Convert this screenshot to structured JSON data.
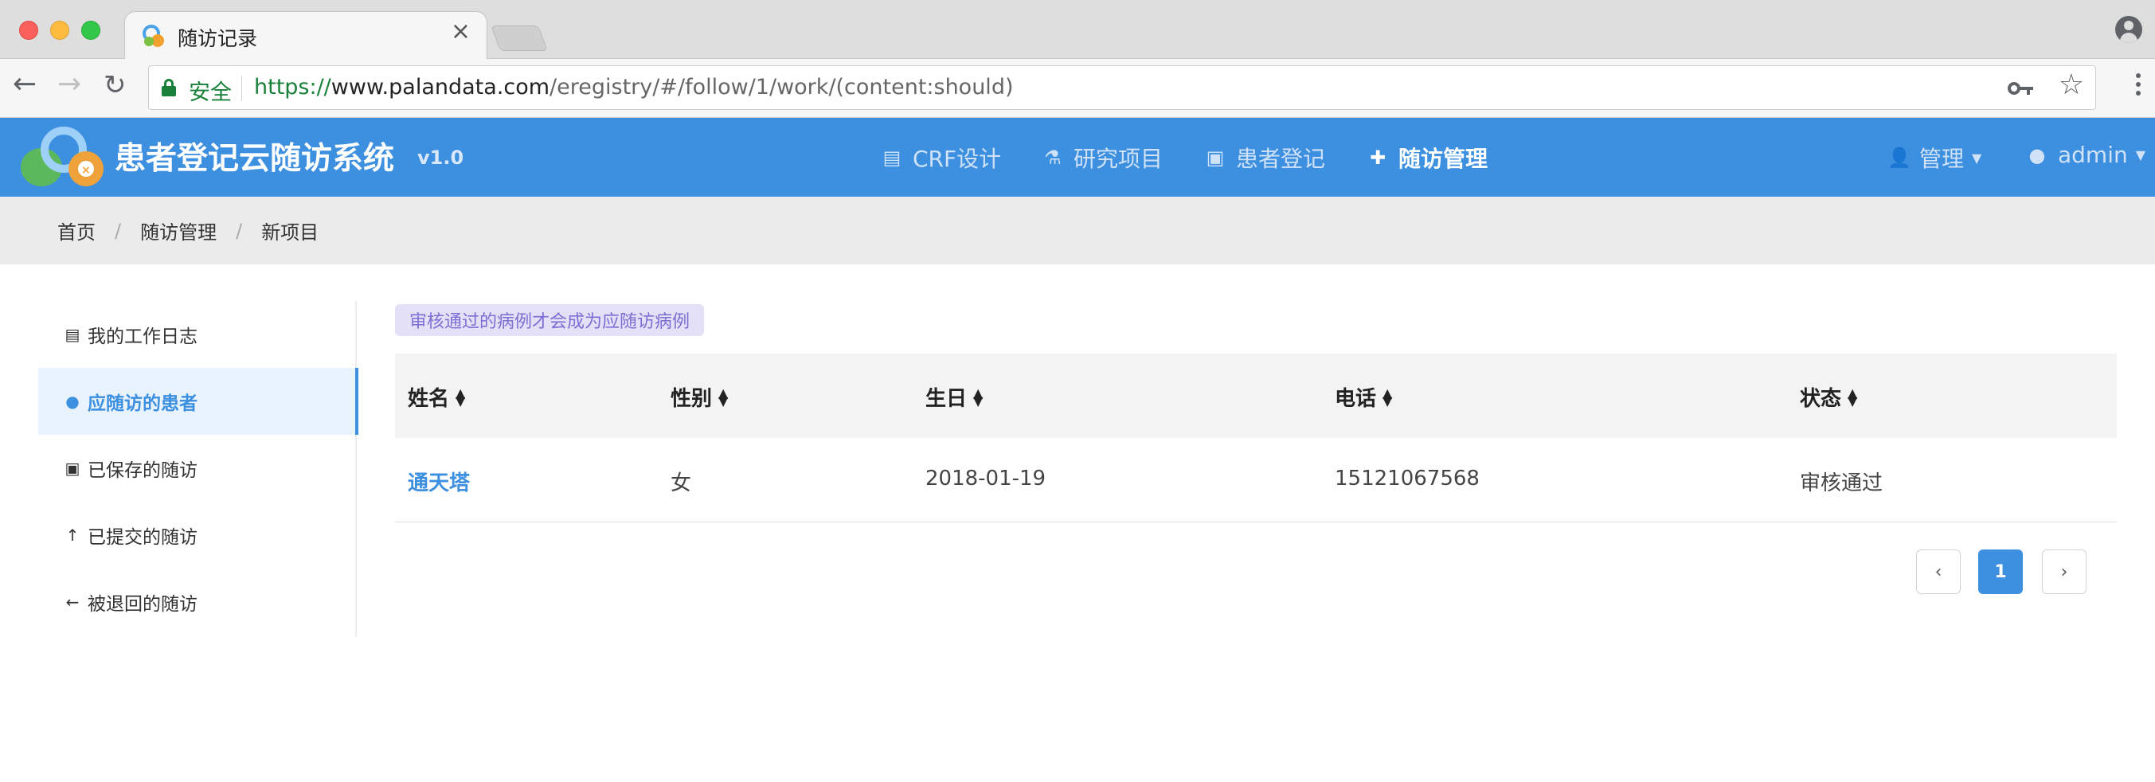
{
  "browser": {
    "tab_title": "随访记录",
    "tab_close": "×",
    "secure_label": "安全",
    "url_scheme": "https://",
    "url_host": "www.palandata.com",
    "url_path": "/eregistry/#/follow/1/work/(content:should)"
  },
  "app": {
    "brand": "患者登记云随访系统",
    "version": "v1.0",
    "nav": {
      "crf": "CRF设计",
      "project": "研究项目",
      "register": "患者登记",
      "follow": "随访管理",
      "admin": "管理",
      "user": "admin"
    },
    "colors": {
      "primary": "#3d8fe0",
      "notice_bg": "#e4e0f7",
      "notice_text": "#7b6fd3"
    }
  },
  "breadcrumb": [
    "首页",
    "随访管理",
    "新项目"
  ],
  "sidebar": {
    "items": [
      {
        "label": "我的工作日志",
        "icon": "book-icon"
      },
      {
        "label": "应随访的患者",
        "icon": "user-icon",
        "active": true
      },
      {
        "label": "已保存的随访",
        "icon": "floppy-icon"
      },
      {
        "label": "已提交的随访",
        "icon": "arrow-up-icon"
      },
      {
        "label": "被退回的随访",
        "icon": "arrow-left-icon"
      }
    ]
  },
  "main": {
    "notice": "审核通过的病例才会成为应随访病例",
    "columns": [
      "姓名",
      "性别",
      "生日",
      "电话",
      "状态"
    ],
    "rows": [
      {
        "name": "通天塔",
        "gender": "女",
        "birthday": "2018-01-19",
        "phone": "15121067568",
        "status": "审核通过"
      }
    ],
    "pagination": {
      "prev": "‹",
      "current": "1",
      "next": "›"
    }
  }
}
